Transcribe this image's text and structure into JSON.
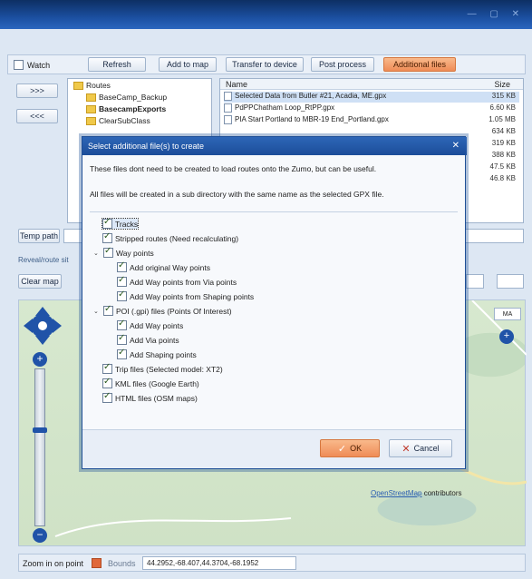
{
  "toolbar": {
    "watch_label": "Watch",
    "refresh_label": "Refresh",
    "add_to_map_label": "Add to map",
    "transfer_label": "Transfer to device",
    "post_process_label": "Post process",
    "additional_files_label": "Additional files"
  },
  "side_buttons": {
    "forward": ">>>",
    "back": "<<<"
  },
  "tree": {
    "items": [
      "Routes",
      "BaseCamp_Backup",
      "BasecampExports",
      "ClearSubClass"
    ]
  },
  "file_list": {
    "col_name": "Name",
    "col_size": "Size",
    "rows": [
      {
        "name": "Selected Data from Butler #21, Acadia, ME.gpx",
        "size": "315 KB"
      },
      {
        "name": "PdPPChatham Loop_RtPP.gpx",
        "size": "6.60 KB"
      },
      {
        "name": "PIA Start Portland to MBR-19 End_Portland.gpx",
        "size": "1.05 MB"
      },
      {
        "name": "",
        "size": "634 KB"
      },
      {
        "name": "",
        "size": "319 KB"
      },
      {
        "name": "",
        "size": "388 KB"
      },
      {
        "name": "",
        "size": "47.5 KB"
      },
      {
        "name": "",
        "size": "46.8 KB"
      }
    ]
  },
  "temp_path_label": "Temp path",
  "reveal_label": "Reveal/route sit",
  "clear_map_label": "Clear map",
  "dialog": {
    "title": "Select additional file(s) to create",
    "line1": "These files dont need to be created to load routes onto the Zumo, but can be useful.",
    "line2": "All files will be created in a sub directory with the same name as the selected GPX file.",
    "options": {
      "tracks": "Tracks",
      "stripped": "Stripped routes (Need recalculating)",
      "waypoints": "Way points",
      "add_original": "Add original Way points",
      "add_via": "Add Way points from Via points",
      "add_shaping": "Add Way points from Shaping points",
      "poi": "POI (.gpi) files (Points Of Interest)",
      "poi_way": "Add Way points",
      "poi_via": "Add Via points",
      "poi_shaping": "Add Shaping points",
      "trip": "Trip files (Selected model: XT2)",
      "kml": "KML files (Google Earth)",
      "html": "HTML files (OSM maps)"
    },
    "ok_label": "OK",
    "cancel_label": "Cancel"
  },
  "map": {
    "attribution_link": "OpenStreetMap",
    "attribution_tail": "contributors",
    "corner_label": "MA"
  },
  "statusbar": {
    "zoom_label": "Zoom in on point",
    "bounds_label": "Bounds",
    "bounds_value": "44.2952,-68.407,44.3704,-68.1952"
  },
  "colors": {
    "title_blue": "#1b4fa0",
    "accent_orange": "#ef8c57",
    "map_green": "#d7e8cf"
  }
}
